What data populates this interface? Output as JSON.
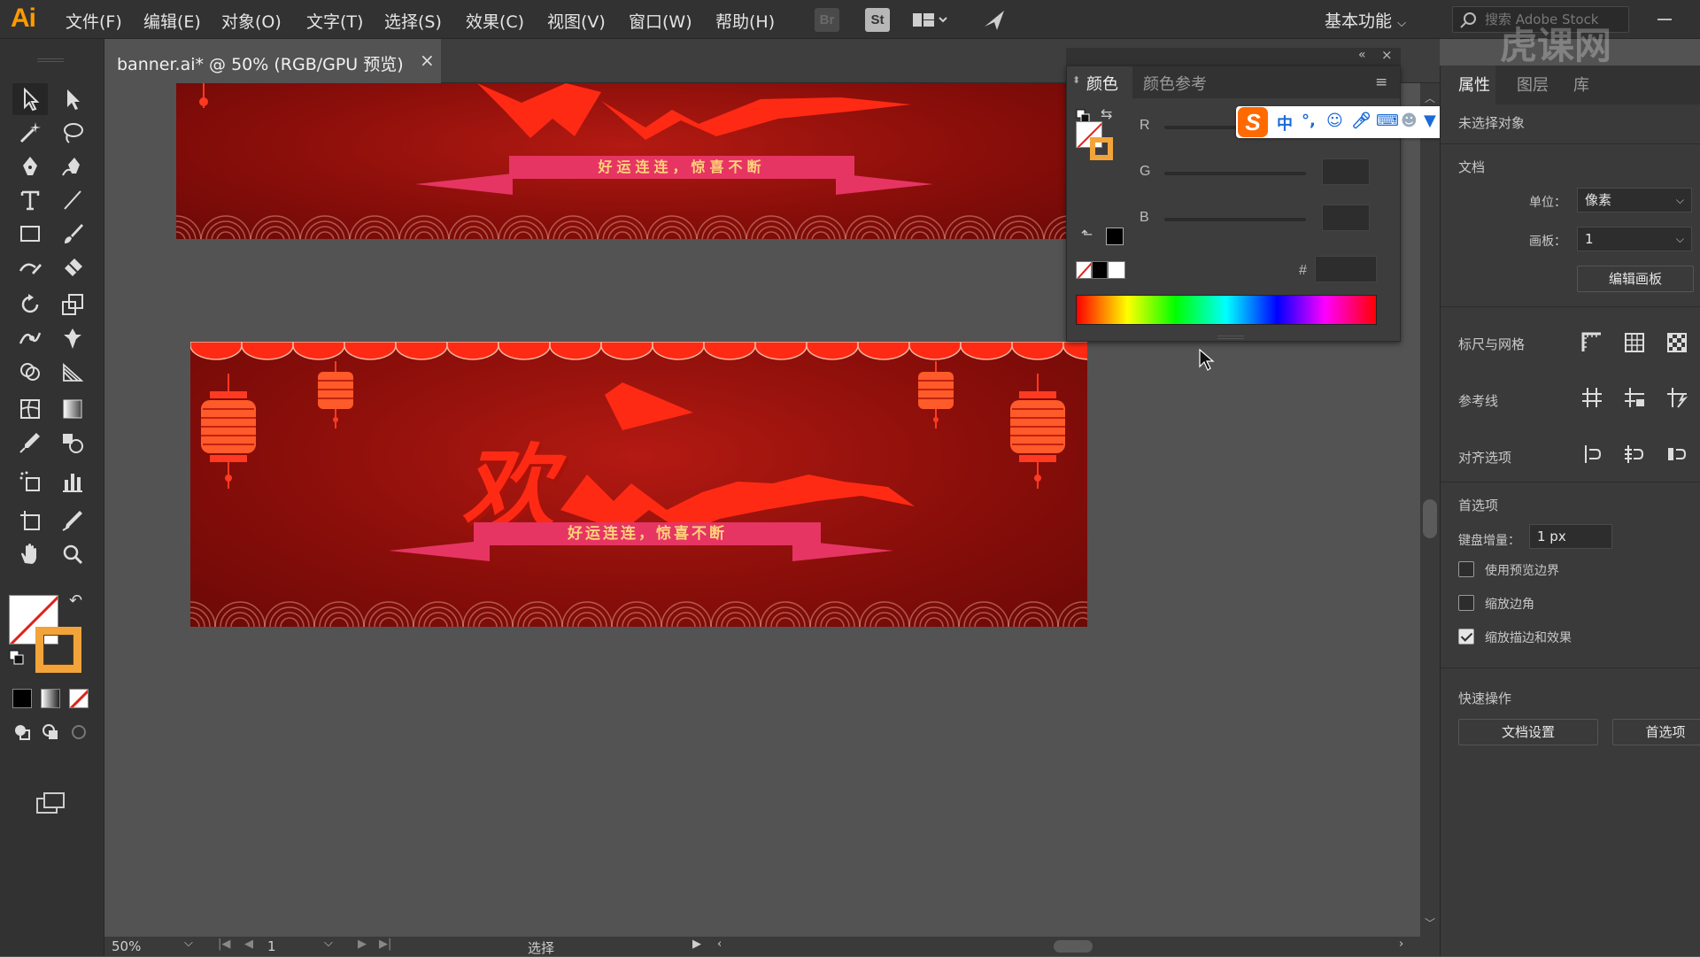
{
  "app": {
    "logo": "Ai"
  },
  "menu": [
    "文件(F)",
    "编辑(E)",
    "对象(O)",
    "文字(T)",
    "选择(S)",
    "效果(C)",
    "视图(V)",
    "窗口(W)",
    "帮助(H)"
  ],
  "top_buttons": {
    "bridge": "Br",
    "stock": "St"
  },
  "workspace": "基本功能",
  "search": {
    "placeholder": "搜索 Adobe Stock"
  },
  "document_tab": {
    "title": "banner.ai* @ 50% (RGB/GPU 预览)",
    "close": "×"
  },
  "artwork": {
    "top_banner_slogan": "好运连连，惊喜不断",
    "main_banner_slogan": "好运连连，惊喜不断",
    "headline_char": "欢",
    "colors": {
      "banner_dark": "#8a0e0a",
      "banner_mid": "#b31a12",
      "accent_red": "#ff2a14",
      "lantern": "#ff5a2a",
      "ribbon": "#e63563",
      "slogan_text": "#ffd27a",
      "scallop_line": "#f2b8a0"
    }
  },
  "color_panel": {
    "tabs": [
      "颜色",
      "颜色参考"
    ],
    "channels": [
      "R",
      "G",
      "B"
    ],
    "hex_label": "#"
  },
  "properties": {
    "tabs": [
      "属性",
      "图层",
      "库"
    ],
    "no_selection": "未选择对象",
    "document_section": "文档",
    "units_label": "单位：",
    "units_value": "像素",
    "artboard_label": "画板：",
    "artboard_value": "1",
    "edit_artboards_btn": "编辑画板",
    "rulers_grids": "标尺与网格",
    "guides": "参考线",
    "snap_options": "对齐选项",
    "preferences": "首选项",
    "key_increment_label": "键盘增量：",
    "key_increment_value": "1 px",
    "checkboxes": [
      {
        "label": "使用预览边界",
        "checked": false
      },
      {
        "label": "缩放边角",
        "checked": false
      },
      {
        "label": "缩放描边和效果",
        "checked": true
      }
    ],
    "quick_actions": "快速操作",
    "doc_setup_btn": "文档设置",
    "prefs_btn": "首选项"
  },
  "status": {
    "zoom": "50%",
    "artboard_num": "1",
    "tool": "选择"
  },
  "ime": {
    "mode": "中"
  },
  "watermark": "虎课网"
}
